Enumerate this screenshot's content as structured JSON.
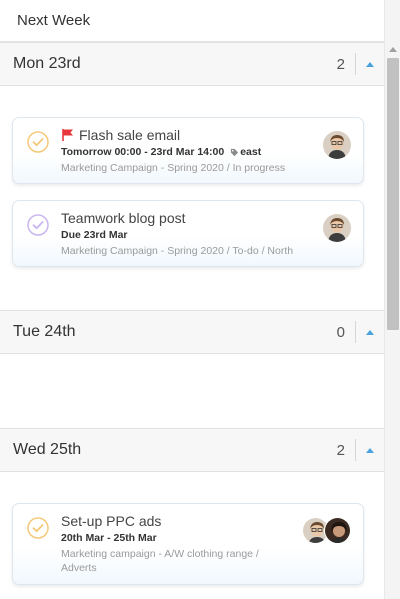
{
  "header": {
    "title": "Next Week"
  },
  "days": [
    {
      "title": "Mon 23rd",
      "count": "2",
      "tasks": [
        {
          "title": "Flash sale email",
          "dates": "Tomorrow 00:00 - 23rd Mar 14:00",
          "tag": "east",
          "path": "Marketing Campaign - Spring 2020 / In progress",
          "check_color": "#f5c97a",
          "flag": "red"
        },
        {
          "title": "Teamwork blog post",
          "dates": "Due 23rd Mar",
          "path": "Marketing Campaign - Spring 2020 / To-do / North",
          "check_color": "#c9b6ee"
        }
      ]
    },
    {
      "title": "Tue 24th",
      "count": "0",
      "tasks": []
    },
    {
      "title": "Wed 25th",
      "count": "2",
      "tasks": [
        {
          "title": "Set-up PPC ads",
          "dates": "20th Mar - 25th Mar",
          "path_line1": "Marketing campaign - A/W clothing range /",
          "path_line2": "Adverts",
          "check_color": "#f5c97a"
        }
      ]
    }
  ],
  "colors": {
    "accent": "#4aa3df",
    "flag": "#e8383d"
  },
  "icons": {
    "check": "check-circle-icon",
    "flag": "flag-icon",
    "tag": "tag-icon",
    "collapse": "chevron-up-icon"
  }
}
